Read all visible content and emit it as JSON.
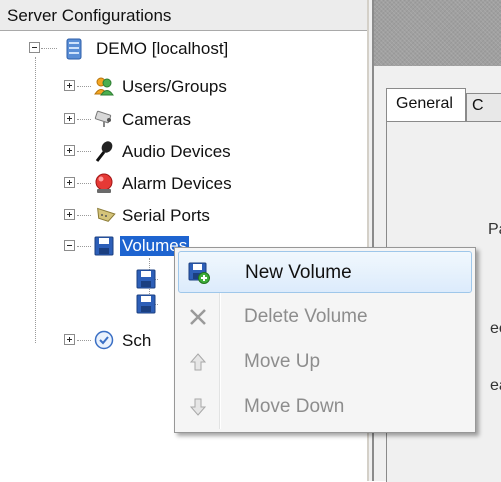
{
  "tree": {
    "header": "Server Configurations",
    "root": {
      "label": "DEMO [localhost]",
      "icon": "database-server-icon"
    },
    "nodes": [
      {
        "label": "Users/Groups",
        "icon": "users-icon"
      },
      {
        "label": "Cameras",
        "icon": "camera-icon"
      },
      {
        "label": "Audio Devices",
        "icon": "microphone-icon"
      },
      {
        "label": "Alarm Devices",
        "icon": "alarm-light-icon"
      },
      {
        "label": "Serial Ports",
        "icon": "serial-port-icon"
      },
      {
        "label": "Volumes",
        "icon": "floppy-disk-icon",
        "selected": true
      },
      {
        "label": "Sch",
        "icon": "clock-icon"
      }
    ]
  },
  "right_pane": {
    "tabs": [
      {
        "label": "General",
        "active": true
      },
      {
        "label": "C"
      }
    ],
    "field_labels": [
      "Path",
      "ee",
      "ea"
    ]
  },
  "context_menu": {
    "items": [
      {
        "label": "New Volume",
        "enabled": true,
        "icon": "new-volume-icon"
      },
      {
        "label": "Delete Volume",
        "enabled": false,
        "icon": "delete-icon"
      },
      {
        "label": "Move Up",
        "enabled": false,
        "icon": "arrow-up-icon"
      },
      {
        "label": "Move Down",
        "enabled": false,
        "icon": "arrow-down-icon"
      }
    ]
  },
  "colors": {
    "selection": "#1e64d0",
    "menu_hover_border": "#9fc7ea",
    "disabled_text": "#8d8d8d"
  }
}
